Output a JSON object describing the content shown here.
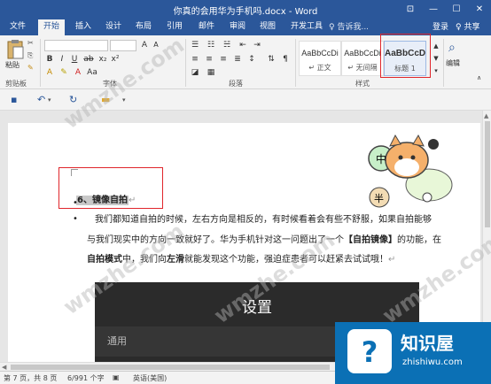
{
  "title": "你真的会用华为手机吗.docx - Word",
  "window_controls": {
    "restore": "⊡",
    "minimize": "—",
    "maximize": "☐",
    "close": "✕"
  },
  "tabs": [
    "文件",
    "开始",
    "插入",
    "设计",
    "布局",
    "引用",
    "邮件",
    "审阅",
    "视图",
    "开发工具"
  ],
  "tell_me": "♀ 告诉我...",
  "login": "登录",
  "share": "♀ 共享",
  "ribbon": {
    "paste": "粘贴",
    "clipboard": "剪贴板",
    "font_group": "字体",
    "paragraph_group": "段落",
    "styles_group": "样式",
    "editing": "编辑",
    "styles": [
      {
        "sample": "AaBbCcDi",
        "name": "↵ 正文"
      },
      {
        "sample": "AaBbCcDi",
        "name": "↵ 无间隔"
      },
      {
        "sample": "AaBbCcD",
        "name": "标题 1"
      }
    ]
  },
  "document": {
    "heading": "6、镜像自拍",
    "mark": "↵",
    "line1_part1": "我们都知道自拍的时候，左右方向是相反的，有时候看着会有些不舒服，如果自拍能够",
    "line2_part1": "与我们现实中的方向一致就好了。华为手机针对这一问题出了一个",
    "line2_bold": "【自拍镜像】",
    "line2_part2": "的功能，在",
    "line3_bold": "自拍模式",
    "line3_part1": "中，我们向",
    "line3_bold2": "左滑",
    "line3_part2": "就能发现这个功能，强迫症患者可以赶紧去试试哦！",
    "phone_title": "设置",
    "phone_item": "通用"
  },
  "statusbar": {
    "page": "第 7 页，共 8 页",
    "words": "6/991 个字",
    "lang": "英语(美国)"
  },
  "badge": {
    "name": "知识屋",
    "url": "zhishiwu.com"
  },
  "watermark_text": "wmzhe.com"
}
